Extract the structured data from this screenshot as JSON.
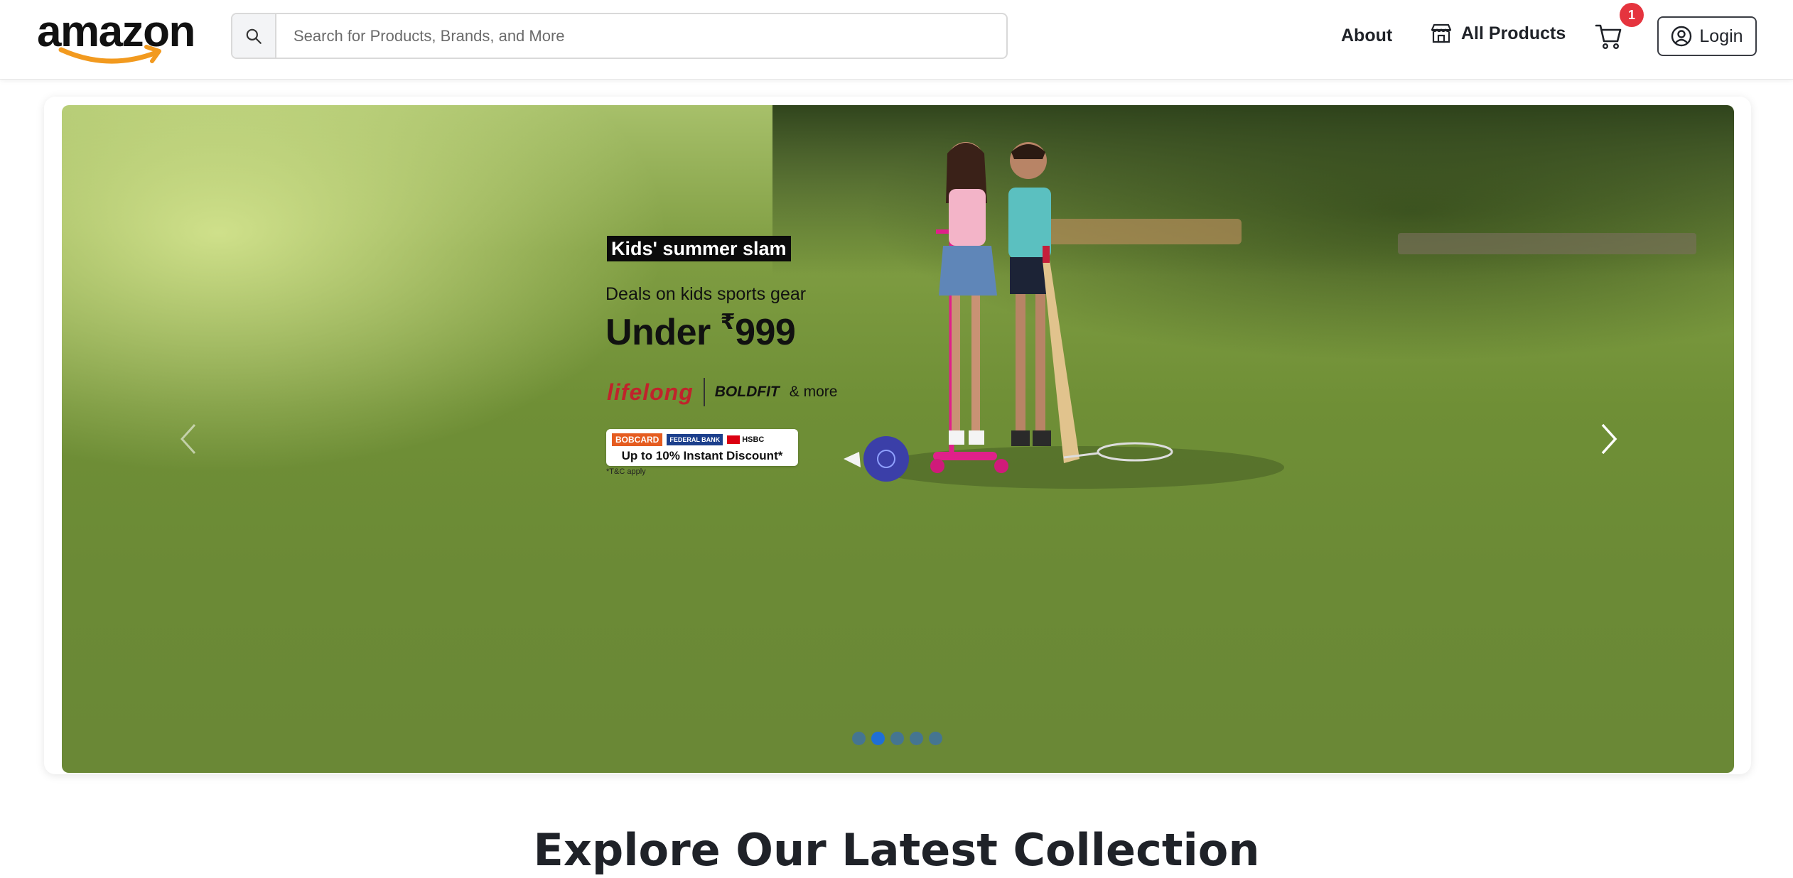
{
  "header": {
    "logo_text": "amazon",
    "search": {
      "placeholder": "Search for Products, Brands, and More",
      "icon": "search-icon"
    },
    "nav": {
      "about_label": "About",
      "all_products_label": "All Products",
      "all_products_icon": "store-icon",
      "cart_icon": "cart-icon",
      "cart_count": "1",
      "login_label": "Login",
      "login_icon": "user-circle-icon"
    }
  },
  "banner": {
    "tag": "Kids' summer slam",
    "deal_text": "Deals on kids sports gear",
    "price_prefix": "Under ",
    "currency": "₹",
    "price": "999",
    "brands": [
      "lifelong",
      "BOLDFIT",
      "& more"
    ],
    "bank_offer": {
      "banks": [
        "BOBCARD",
        "FEDERAL BANK",
        "HSBC"
      ],
      "offer_text": "Up to 10% Instant Discount*"
    },
    "tnc": "*T&C apply",
    "carousel": {
      "total_slides": 5,
      "active_index": 1
    }
  },
  "main": {
    "section_title": "Explore Our Latest Collection"
  },
  "colors": {
    "badge": "#e5343e",
    "active_dot": "#1f6fd6",
    "text_dark": "#1f2228"
  }
}
